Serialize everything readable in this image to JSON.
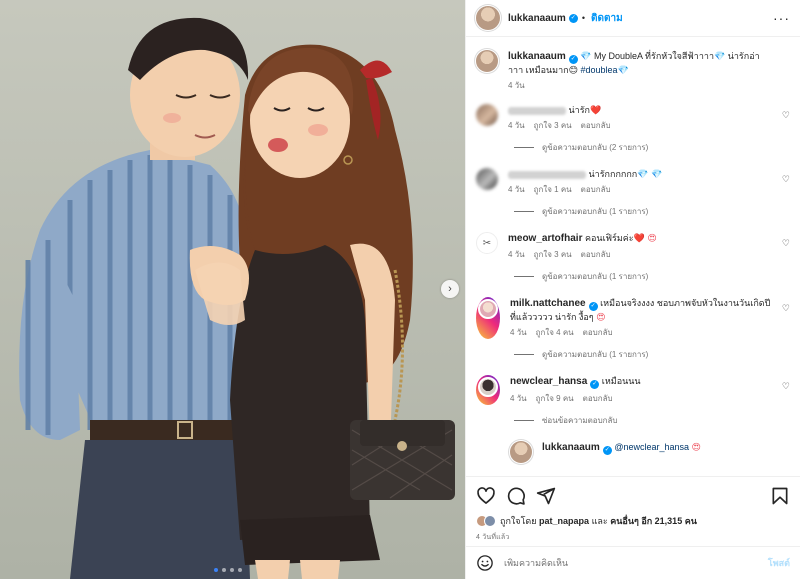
{
  "post": {
    "author": "lukkanaaum",
    "follow_label": "ติดตาม",
    "more_icon": "more-horizontal-icon",
    "caption_prefix": "💎 My DoubleA ที่รักหัวใจสีฟ้าาาา💎 น่ารักอ่าาาา เหมือนมาก😊",
    "caption_hashtag": "#doublea",
    "caption_suffix": "💎",
    "caption_time": "4 วัน"
  },
  "comments": [
    {
      "user": "",
      "blurred": true,
      "text": "น่ารัก",
      "emoji": "❤️",
      "time": "4 วัน",
      "likes": "ถูกใจ 3 คน",
      "reply": "ตอบกลับ",
      "view_replies": "ดูข้อความตอบกลับ (2 รายการ)"
    },
    {
      "user": "",
      "blurred": true,
      "text": "น่ารักกกกกก",
      "emoji": "💎 💎",
      "time": "4 วัน",
      "likes": "ถูกใจ 1 คน",
      "reply": "ตอบกลับ",
      "view_replies": "ดูข้อความตอบกลับ (1 รายการ)"
    },
    {
      "user": "meow_artofhair",
      "text": "คอนเฟิร์มค่ะ",
      "emoji": "❤️ 😍",
      "time": "4 วัน",
      "likes": "ถูกใจ 3 คน",
      "reply": "ตอบกลับ",
      "view_replies": "ดูข้อความตอบกลับ (1 รายการ)"
    },
    {
      "user": "milk.nattchanee",
      "verified": true,
      "text": "เหมือนจริงงงง ชอบภาพจับหัวในงานวันเกิดปีที่แล้ววววว น่ารัก งื้อๆ",
      "emoji": "😍",
      "time": "4 วัน",
      "likes": "ถูกใจ 4 คน",
      "reply": "ตอบกลับ",
      "view_replies": "ดูข้อความตอบกลับ (1 รายการ)"
    },
    {
      "user": "newclear_hansa",
      "verified": true,
      "text": "เหมือนนน",
      "emoji": "",
      "time": "4 วัน",
      "likes": "ถูกใจ 9 คน",
      "reply": "ตอบกลับ",
      "view_replies": "ซ่อนข้อความตอบกลับ"
    }
  ],
  "reply_preview": {
    "user": "lukkanaaum",
    "mention": "@newclear_hansa",
    "emoji": "😍"
  },
  "actions": {
    "like_icon": "heart-outline-icon",
    "comment_icon": "comment-icon",
    "share_icon": "send-icon",
    "save_icon": "bookmark-icon"
  },
  "likes": {
    "prefix": "ถูกใจโดย",
    "first_user": "pat_napapa",
    "middle": "และ",
    "others": "คนอื่นๆ อีก 21,315 คน"
  },
  "time_ago": "4 วันที่แล้ว",
  "add_comment": {
    "placeholder": "เพิ่มความคิดเห็น",
    "post_label": "โพสต์"
  },
  "carousel": {
    "next_icon": "chevron-right-icon",
    "slides": 4,
    "active": 1
  },
  "colors": {
    "accent": "#0095f6",
    "heart": "#ed4956",
    "muted": "#737373"
  }
}
